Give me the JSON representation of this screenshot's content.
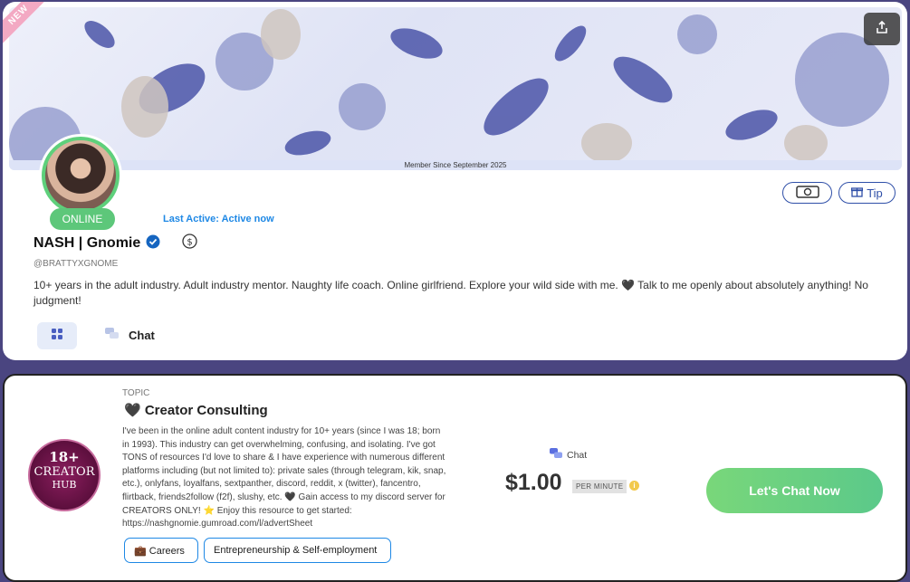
{
  "profile": {
    "new_badge": "NEW",
    "member_since": "Member Since September 2025",
    "status": "ONLINE",
    "last_active": "Last Active: Active now",
    "name": "NASH | Gnomie",
    "handle": "@BRATTYXGNOME",
    "bio": "10+ years in the adult industry. Adult industry mentor. Naughty life coach. Online girlfriend. Explore your wild side with me. 🖤 Talk to me openly about absolutely anything! No judgment!",
    "tip_label": "Tip",
    "tabs": [
      {
        "label": ""
      },
      {
        "label": "Chat"
      }
    ],
    "icons": {
      "share": "share-icon",
      "cash": "cash-icon",
      "gift": "gift-icon",
      "verified": "verified-badge-icon",
      "dollar": "dollar-coin-icon",
      "grid": "grid-icon",
      "chat": "chat-bubbles-icon"
    },
    "colors": {
      "online": "#5dc77a",
      "accent": "#1e88e5",
      "verified": "#1565c0"
    }
  },
  "topic": {
    "label": "TOPIC",
    "title": "🖤 Creator Consulting",
    "logo_lines": [
      "18+",
      "CREATOR",
      "HUB"
    ],
    "description": "I've been in the online adult content industry for 10+ years (since I was 18; born in 1993). This industry can get overwhelming, confusing, and isolating. I've got TONS of resources I'd love to share & I have experience with numerous different platforms including (but not limited to): private sales (through telegram, kik, snap, etc.), onlyfans, loyalfans, sextpanther, discord, reddit, x (twitter), fancentro, flirtback, friends2follow (f2f), slushy, etc. 🖤 Gain access to my discord server for CREATORS ONLY! ⭐ Enjoy this resource to get started: https://nashgnomie.gumroad.com/l/advertSheet",
    "tags": [
      {
        "label": "💼 Careers"
      },
      {
        "label": "Entrepreneurship & Self-employment"
      }
    ],
    "chat_label": "Chat",
    "price": "$1.00",
    "price_unit": "PER MINUTE",
    "cta": "Let's Chat Now"
  }
}
